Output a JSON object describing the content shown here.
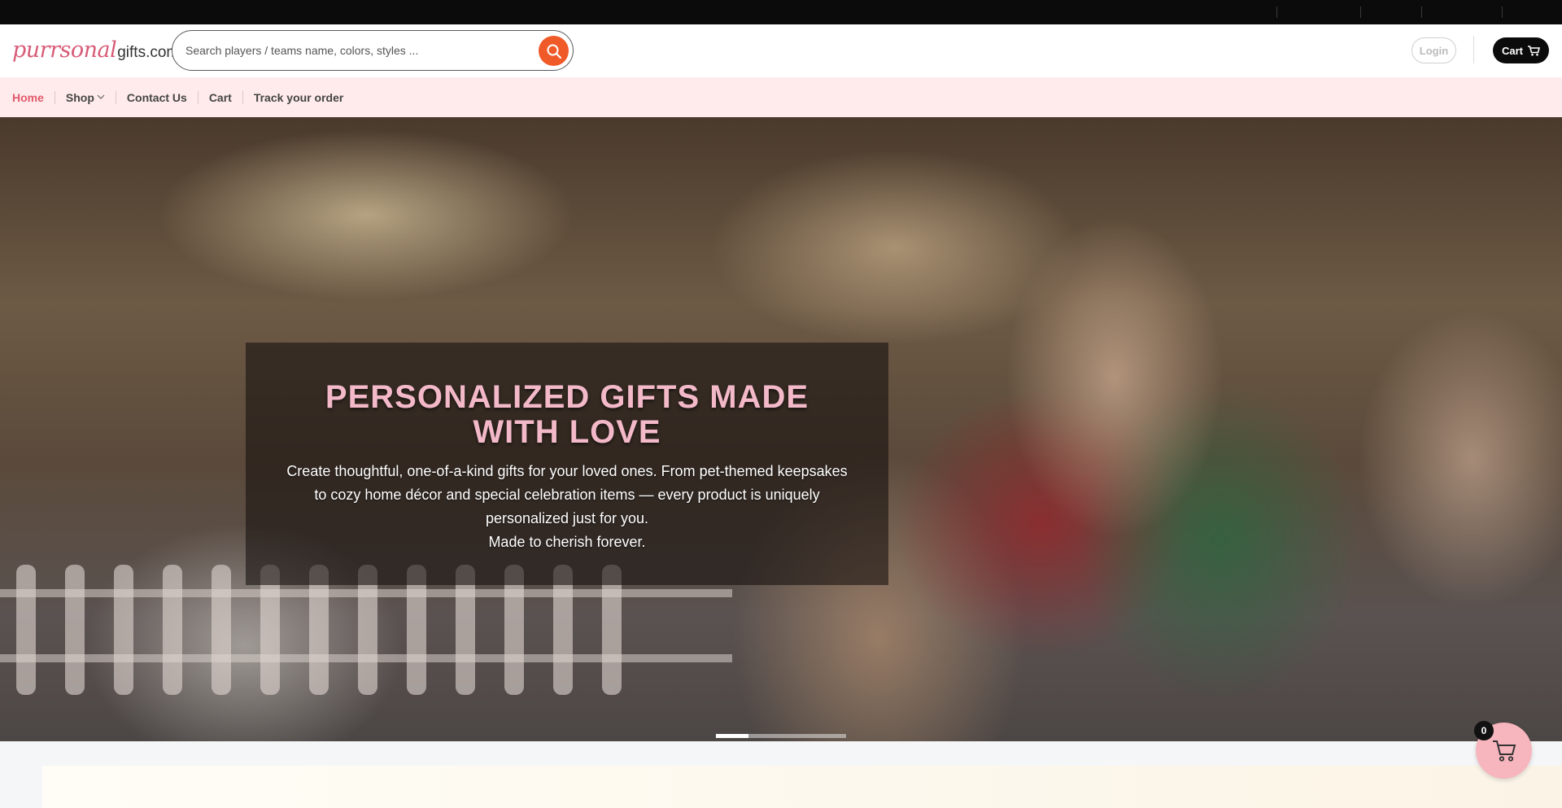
{
  "logo": {
    "script": "purrsonal",
    "plain": "gifts.com"
  },
  "search": {
    "placeholder": "Search players / teams name, colors, styles ...",
    "icon": "search-icon"
  },
  "header": {
    "login_label": "Login",
    "cart_label": "Cart",
    "cart_icon": "cart-icon"
  },
  "nav": {
    "items": [
      {
        "label": "Home",
        "active": true
      },
      {
        "label": "Shop",
        "has_dropdown": true
      },
      {
        "label": "Contact Us"
      },
      {
        "label": "Cart"
      },
      {
        "label": "Track your order"
      }
    ]
  },
  "hero": {
    "title": " PERSONALIZED GIFTS MADE WITH LOVE ",
    "text_1": "Create thoughtful, one-of-a-kind gifts for your loved ones. From pet-themed keepsakes to cozy home décor and special celebration items — every product is uniquely personalized just for you.",
    "text_2": "Made to cherish forever.",
    "slide_current": 1,
    "slide_total": 4
  },
  "floating_cart": {
    "count": "0"
  },
  "colors": {
    "accent": "#f05a28",
    "brand_pink": "#e2596b",
    "nav_bg": "#ffebeb",
    "title_pink": "#f3b9c9"
  }
}
